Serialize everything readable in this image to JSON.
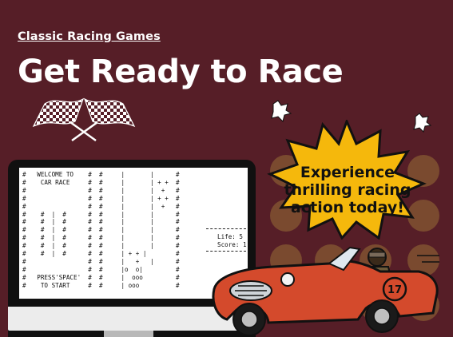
{
  "header": {
    "breadcrumb": "Classic Racing Games",
    "title": "Get Ready to Race"
  },
  "callout": {
    "text": "Experience thrilling racing action today!"
  },
  "game_screen": {
    "ascii": "#   WELCOME TO    #  #     |       |      #\n#    CAR RACE     #  #     |       | + +  #\n#                 #  #     |       |  +   #\n#                 #  #     |       | + +  #\n#                 #  #     |       |  +   #\n#    #  |  #      #  #     |       |      #\n#    #  |  #      #  #     |       |      #\n#    #  |  #      #  #     |       |      #\n#    #  |  #      #  #     |       |      #\n#    #  |  #      #  #     |       |      #\n#    #  |  #      #  #     | + + |        #\n#                 #  #     |   +   |      #\n#                 #  #     |o  o|         #\n#   PRESS'SPACE'  #  #     |  ooo         #\n#    TO START     #  #     | ooo          #",
    "life_label": "Life: 5",
    "score_label": "Score: 1"
  },
  "colors": {
    "background": "#561e27",
    "accent_orange": "#f5a623",
    "dots": "#7a4a2f"
  }
}
